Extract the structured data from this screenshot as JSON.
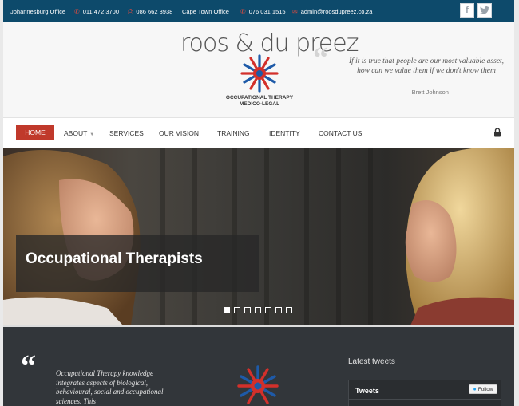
{
  "topbar": {
    "johannesburg_label": "Johannesburg Office",
    "jhb_phone": "011 472 3700",
    "fax": "086 662 3938",
    "capetown_label": "Cape Town Office",
    "ct_phone": "076 031 1515",
    "email": "admin@roosdupreez.co.za",
    "facebook": "f",
    "twitter": "t"
  },
  "header": {
    "logo_text": "roos & du preez",
    "logo_sub": "OCCUPATIONAL THERAPY MEDICO-LEGAL",
    "quote_mark": "“",
    "quote_text": "If it is true that people are our most valuable asset, how can we value them if we don't know them",
    "quote_author": "— Brett Johnson"
  },
  "nav": {
    "items": [
      "HOME",
      "ABOUT",
      "SERVICES",
      "OUR VISION",
      "TRAINING",
      "IDENTITY",
      "CONTACT US"
    ],
    "active": "HOME"
  },
  "hero": {
    "caption": "Occupational Therapists",
    "slides": 7,
    "active_slide": 1
  },
  "footer": {
    "quote_mark": "“",
    "quote_text": "Occupational Therapy knowledge integrates aspects of biological, behavioural, social and occupational sciences. This",
    "tweets_title": "Latest tweets",
    "tweets_box_title": "Tweets",
    "follow_label": "Follow"
  },
  "colors": {
    "topbar": "#0d4a6b",
    "accent": "#c0392b",
    "footer": "#32363a"
  }
}
